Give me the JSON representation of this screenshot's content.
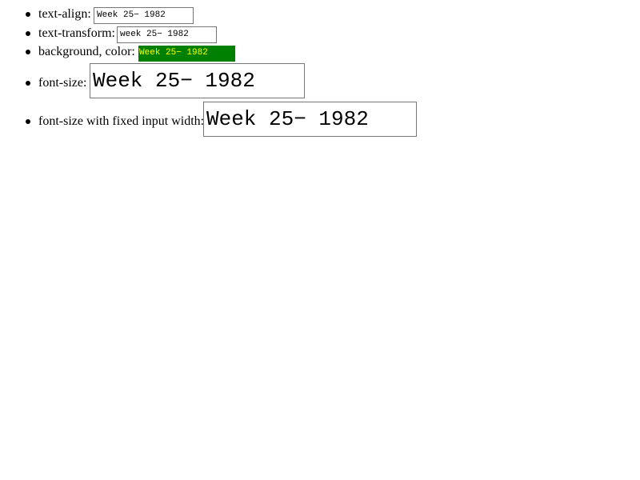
{
  "items": [
    {
      "label": "text-align:",
      "value": "Week 25− 1982"
    },
    {
      "label": "text-transform:",
      "value": "week 25− 1982"
    },
    {
      "label": "background, color:",
      "value": "Week 25− 1982"
    },
    {
      "label": "font-size:",
      "value": "Week 25− 1982"
    },
    {
      "label": "font-size with fixed input width:",
      "value": "Week 25− 1982"
    }
  ],
  "colors": {
    "highlight_background": "#008000",
    "highlight_text": "#ffff00"
  }
}
